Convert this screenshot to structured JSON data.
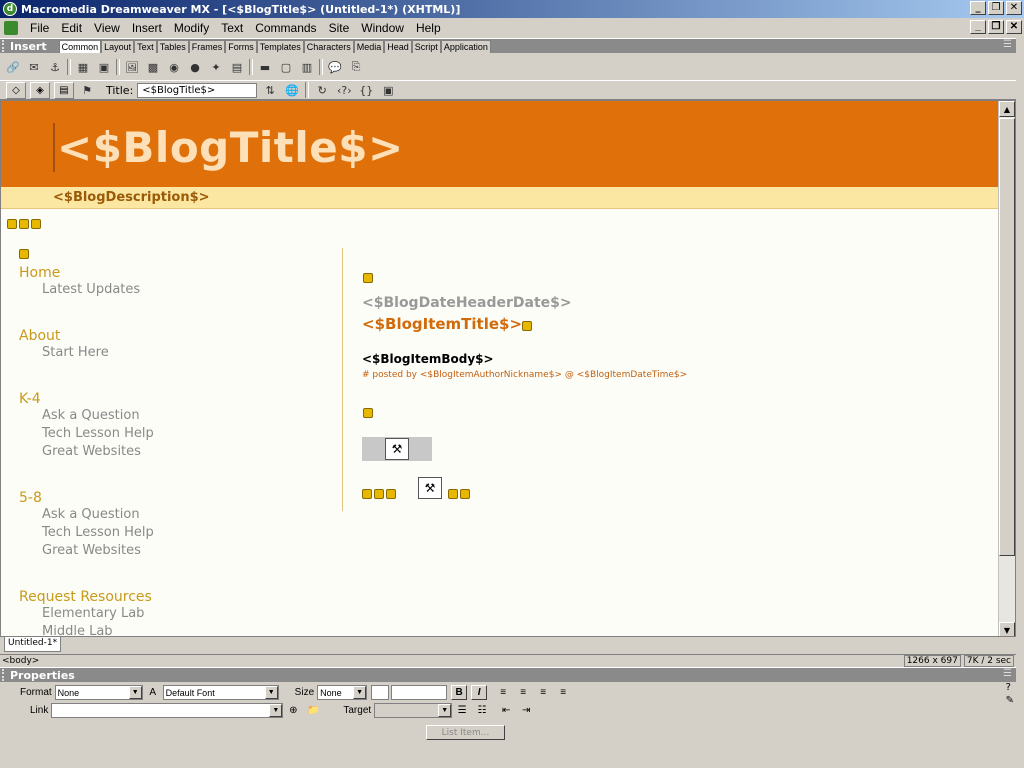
{
  "window": {
    "title": "Macromedia Dreamweaver MX - [<$BlogTitle$> (Untitled-1*) (XHTML)]",
    "controls": [
      "_",
      "❐",
      "✕"
    ]
  },
  "menu": [
    {
      "label": "File"
    },
    {
      "label": "Edit"
    },
    {
      "label": "View"
    },
    {
      "label": "Insert"
    },
    {
      "label": "Modify"
    },
    {
      "label": "Text"
    },
    {
      "label": "Commands"
    },
    {
      "label": "Site"
    },
    {
      "label": "Window"
    },
    {
      "label": "Help"
    }
  ],
  "insert_panel": {
    "title": "Insert",
    "tabs": [
      "Common",
      "Layout",
      "Text",
      "Tables",
      "Frames",
      "Forms",
      "Templates",
      "Characters",
      "Media",
      "Head",
      "Script",
      "Application"
    ],
    "active_tab": "Common"
  },
  "doc_toolbar": {
    "title_label": "Title:",
    "title_value": "<$BlogTitle$>"
  },
  "page": {
    "blog_title": "<$BlogTitle$>",
    "blog_description": "<$BlogDescription$>",
    "nav": [
      {
        "heading": "Home",
        "links": [
          "Latest Updates"
        ]
      },
      {
        "heading": "About",
        "links": [
          "Start Here"
        ]
      },
      {
        "heading": "K-4",
        "links": [
          "Ask a Question",
          "Tech Lesson Help",
          "Great Websites"
        ]
      },
      {
        "heading": "5-8",
        "links": [
          "Ask a Question",
          "Tech Lesson Help",
          "Great Websites"
        ]
      },
      {
        "heading": "Request Resources",
        "links": [
          "Elementary Lab",
          "Middle Lab"
        ]
      }
    ],
    "post": {
      "date_header": "<$BlogDateHeaderDate$>",
      "item_title": "<$BlogItemTitle$>",
      "item_body": "<$BlogItemBody$>",
      "posted_by": "# posted by <$BlogItemAuthorNickname$> @ <$BlogItemDateTime$>"
    }
  },
  "doc_tab": "Untitled-1*",
  "status": {
    "tag_selector": "<body>",
    "window_size": "1266 x 697",
    "download": "7K / 2 sec"
  },
  "properties": {
    "title": "Properties",
    "format_label": "Format",
    "format_value": "None",
    "font_value": "Default Font",
    "size_label": "Size",
    "size_value": "None",
    "link_label": "Link",
    "link_value": "",
    "target_label": "Target",
    "list_item_button": "List Item..."
  },
  "colors": {
    "header_orange": "#e0700a",
    "title_text": "#fde0b8",
    "desc_bar": "#fbe7a2",
    "nav_heading": "#c79a1a",
    "post_title": "#d06a0a"
  }
}
